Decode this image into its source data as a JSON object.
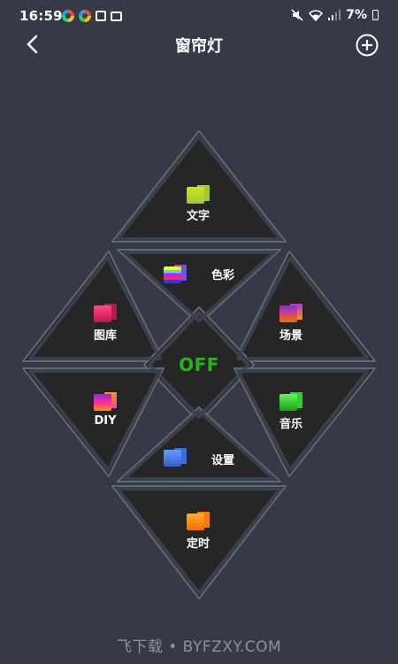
{
  "status": {
    "time": "16:59",
    "battery": "7%"
  },
  "header": {
    "title": "窗帘灯"
  },
  "modes": {
    "text": "文字",
    "color": "色彩",
    "gallery": "图库",
    "scene": "场景",
    "power": "OFF",
    "diy": "DIY",
    "music": "音乐",
    "settings": "设置",
    "timer": "定时"
  },
  "watermark": "飞下载 • BYFZXY.COM",
  "colors": {
    "background": "#363a47",
    "tile": "#262626",
    "tile_border": "#5e6a78",
    "power_off": "#2bb11a"
  }
}
